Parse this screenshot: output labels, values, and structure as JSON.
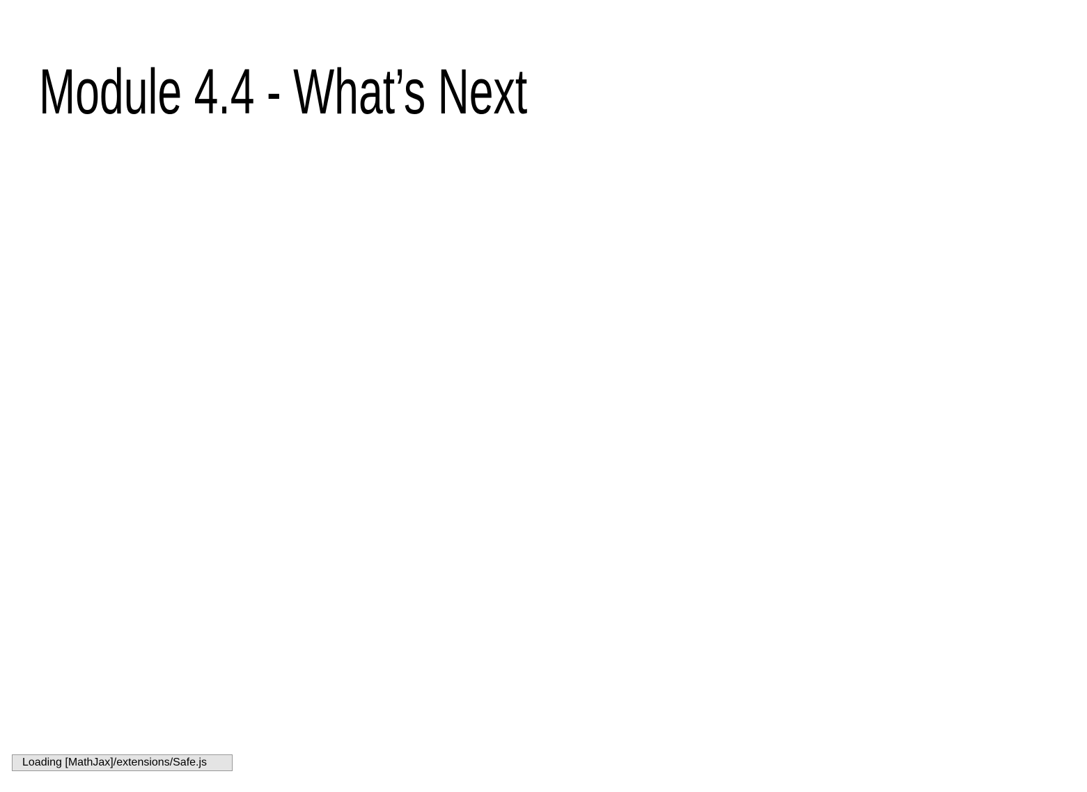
{
  "slide": {
    "title": "Module 4.4 - What’s Next"
  },
  "status": {
    "message": "Loading [MathJax]/extensions/Safe.js"
  }
}
